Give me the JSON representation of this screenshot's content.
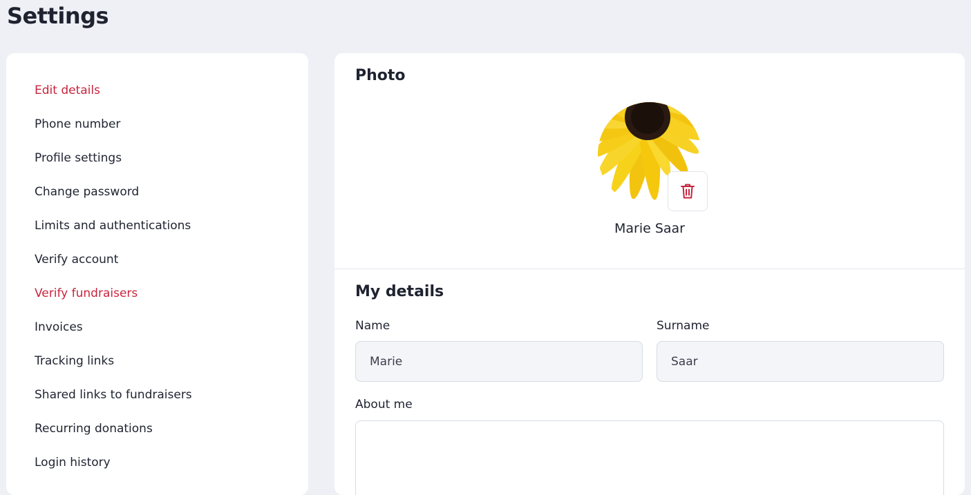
{
  "page": {
    "title": "Settings"
  },
  "sidebar": {
    "items": [
      {
        "label": "Edit details",
        "accent": true
      },
      {
        "label": "Phone number",
        "accent": false
      },
      {
        "label": "Profile settings",
        "accent": false
      },
      {
        "label": "Change password",
        "accent": false
      },
      {
        "label": "Limits and authentications",
        "accent": false
      },
      {
        "label": "Verify account",
        "accent": false
      },
      {
        "label": "Verify fundraisers",
        "accent": true
      },
      {
        "label": "Invoices",
        "accent": false
      },
      {
        "label": "Tracking links",
        "accent": false
      },
      {
        "label": "Shared links to fundraisers",
        "accent": false
      },
      {
        "label": "Recurring donations",
        "accent": false
      },
      {
        "label": "Login history",
        "accent": false
      }
    ]
  },
  "photo_section": {
    "title": "Photo",
    "profile_name": "Marie Saar",
    "delete_icon": "trash-icon"
  },
  "details_section": {
    "title": "My details",
    "name_label": "Name",
    "name_value": "Marie",
    "surname_label": "Surname",
    "surname_value": "Saar",
    "about_label": "About me",
    "about_value": ""
  },
  "colors": {
    "accent": "#c8243d",
    "text": "#1f2330",
    "background": "#eef0f5",
    "card": "#ffffff",
    "input_bg": "#f4f5f8"
  }
}
